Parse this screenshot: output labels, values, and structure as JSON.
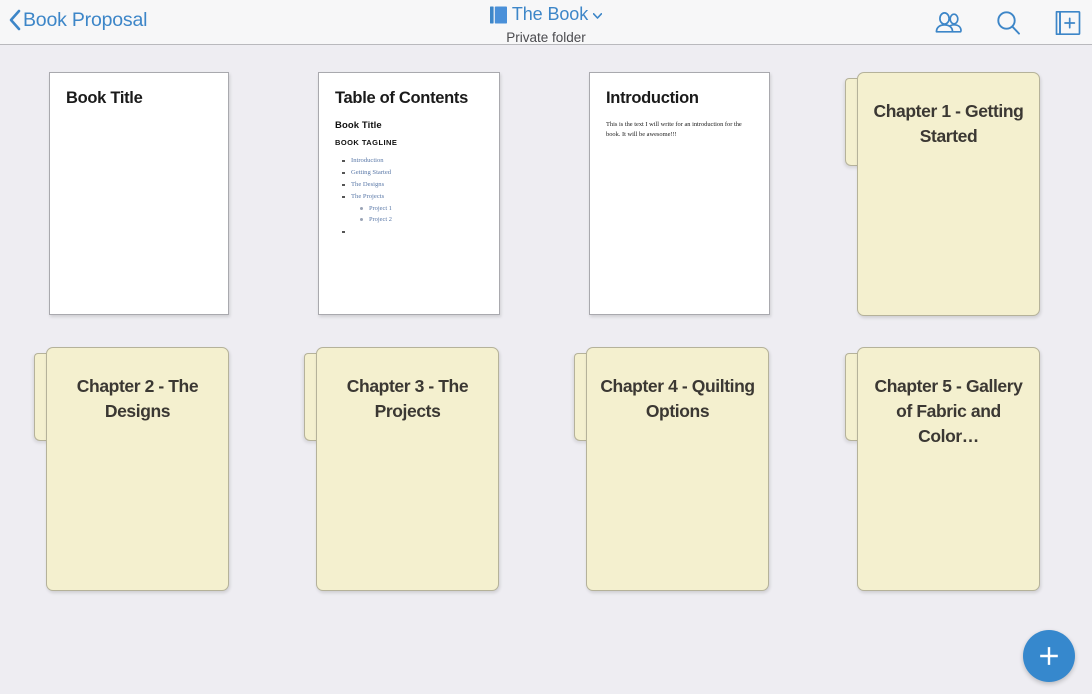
{
  "header": {
    "back_label": "Book Proposal",
    "back_icon": "chevron-left-icon",
    "title": "The Book",
    "title_icon": "book-icon",
    "title_caret_icon": "chevron-down-icon",
    "subtitle": "Private folder",
    "accent_color": "#3d86c8",
    "actions": [
      {
        "name": "collaborators-icon",
        "label": "Collaborators"
      },
      {
        "name": "search-icon",
        "label": "Search"
      },
      {
        "name": "new-document-icon",
        "label": "New Document"
      }
    ]
  },
  "canvas": {
    "background_color": "#eeedf2",
    "items": [
      {
        "kind": "document",
        "name": "book-title",
        "title": "Book Title",
        "body": []
      },
      {
        "kind": "document",
        "name": "table-of-contents",
        "title": "Table of Contents",
        "heading": "Book Title",
        "tagline": "BOOK TAGLINE",
        "toc": [
          {
            "label": "Introduction",
            "children": []
          },
          {
            "label": "Getting Started",
            "children": []
          },
          {
            "label": "The Designs",
            "children": []
          },
          {
            "label": "The Projects",
            "children": [
              "Project 1",
              "Project 2"
            ]
          },
          {
            "label": "",
            "children": []
          }
        ]
      },
      {
        "kind": "document",
        "name": "introduction",
        "title": "Introduction",
        "body": [
          "This is the text I will write for an introduction for the book. It will be awesome!!!"
        ]
      },
      {
        "kind": "folder",
        "name": "chapter-1",
        "label": "Chapter 1 - Getting Started"
      },
      {
        "kind": "folder",
        "name": "chapter-2",
        "label": "Chapter 2 - The Designs"
      },
      {
        "kind": "folder",
        "name": "chapter-3",
        "label": "Chapter 3 - The Projects"
      },
      {
        "kind": "folder",
        "name": "chapter-4",
        "label": "Chapter 4 - Quilting Options"
      },
      {
        "kind": "folder",
        "name": "chapter-5",
        "label": "Chapter 5 - Gallery of Fabric and Color…"
      }
    ]
  },
  "fab": {
    "name": "add-button",
    "icon": "plus-icon",
    "color": "#3688cd"
  }
}
